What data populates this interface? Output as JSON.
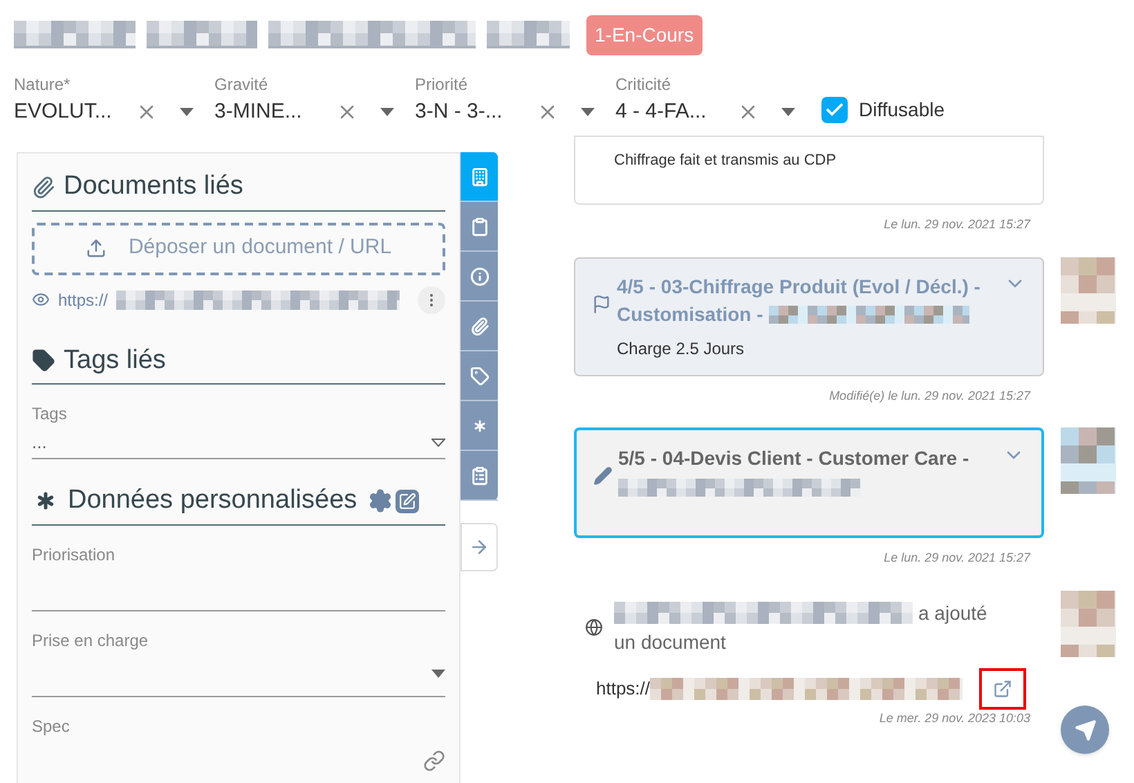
{
  "status_badge": "1-En-Cours",
  "filters": [
    {
      "label": "Nature*",
      "value": "EVOLUT..."
    },
    {
      "label": "Gravité",
      "value": "3-MINE..."
    },
    {
      "label": "Priorité",
      "value": "3-N - 3-..."
    },
    {
      "label": "Criticité",
      "value": "4 - 4-FA..."
    }
  ],
  "diffusable": {
    "label": "Diffusable",
    "checked": true
  },
  "side_tabs": [
    {
      "kind": "building",
      "selected": true
    },
    {
      "kind": "clipboard",
      "selected": false
    },
    {
      "kind": "info",
      "selected": false
    },
    {
      "kind": "paperclip",
      "selected": false
    },
    {
      "kind": "tag",
      "selected": false
    },
    {
      "kind": "asterisk",
      "selected": false
    },
    {
      "kind": "list",
      "selected": false
    }
  ],
  "documents": {
    "title": "Documents liés",
    "dropzone": "Déposer un document / URL",
    "link": "https://"
  },
  "tags": {
    "title": "Tags liés",
    "field_label": "Tags",
    "value": "..."
  },
  "custom": {
    "title": "Données personnalisées",
    "fields": [
      {
        "kind": "text",
        "label": "Priorisation"
      },
      {
        "kind": "select",
        "label": "Prise en charge"
      },
      {
        "kind": "link",
        "label": "Spec"
      }
    ]
  },
  "timeline": [
    {
      "kind": "note",
      "body": "Chiffrage fait et transmis au CDP",
      "time": "Le lun. 29 nov. 2021 15:27"
    },
    {
      "kind": "step",
      "title": "4/5 - 03-Chiffrage Produit (Evol / Décl.) - Customisation -",
      "body": "Charge 2.5 Jours",
      "selected": false,
      "time": "Modifié(e) le lun. 29 nov. 2021 15:27"
    },
    {
      "kind": "step",
      "title": "5/5 - 04-Devis Client - Customer Care -",
      "selected": true,
      "time": "Le lun. 29 nov. 2021 15:27"
    },
    {
      "kind": "activity",
      "action": "a ajouté",
      "action_line2": "un document",
      "link": "https://",
      "highlighted": true,
      "time": "Le mer. 29 nov. 2023 10:03"
    }
  ]
}
